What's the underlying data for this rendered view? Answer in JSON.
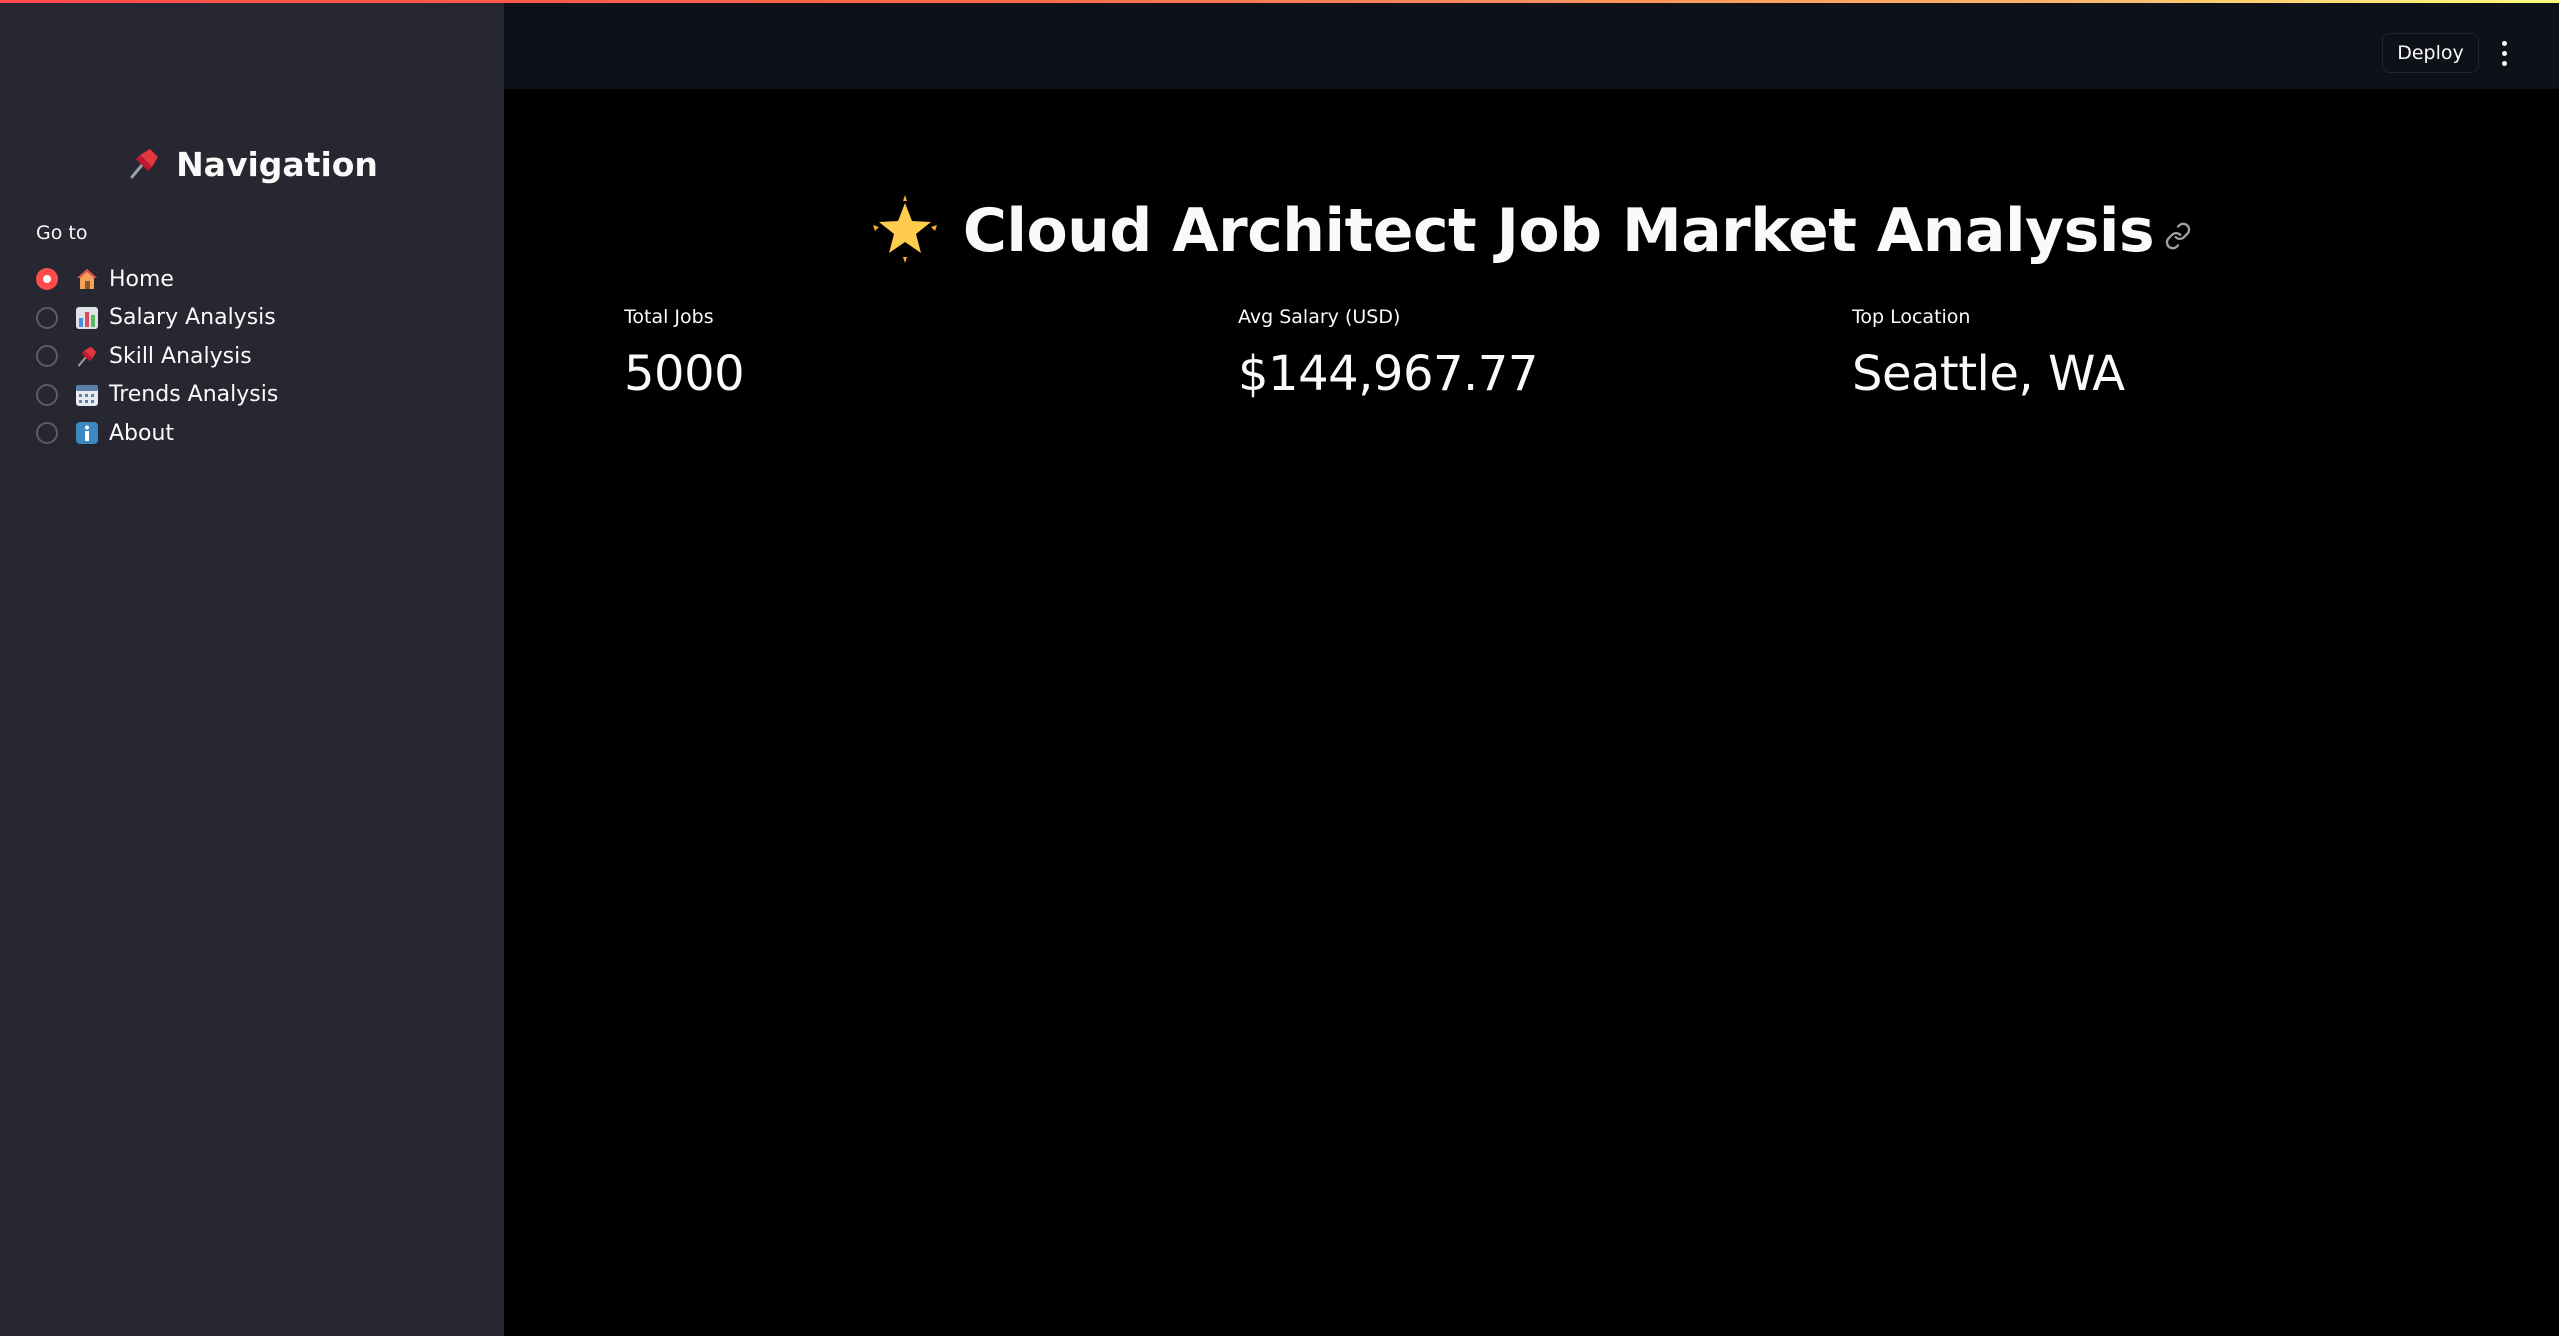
{
  "header": {
    "deploy_label": "Deploy",
    "menu_icon": "kebab-menu-icon"
  },
  "sidebar": {
    "title": "Navigation",
    "title_icon": "pushpin-icon",
    "goto_label": "Go to",
    "selected": "Home",
    "accent_color": "#ff4b4b",
    "items": [
      {
        "label": "Home",
        "icon": "house-icon",
        "checked": true
      },
      {
        "label": "Salary Analysis",
        "icon": "bar-chart-icon",
        "checked": false
      },
      {
        "label": "Skill Analysis",
        "icon": "pushpin-icon",
        "checked": false
      },
      {
        "label": "Trends Analysis",
        "icon": "calendar-icon",
        "checked": false
      },
      {
        "label": "About",
        "icon": "info-icon",
        "checked": false
      }
    ]
  },
  "main": {
    "title": "Cloud Architect Job Market Analysis",
    "title_icon": "glowing-star-icon",
    "anchor_icon": "link-icon",
    "metrics": [
      {
        "label": "Total Jobs",
        "value": "5000"
      },
      {
        "label": "Avg Salary (USD)",
        "value": "$144,967.77"
      },
      {
        "label": "Top Location",
        "value": "Seattle, WA"
      }
    ]
  },
  "colors": {
    "sidebar_bg": "#262730",
    "header_bg": "#0e1117",
    "main_bg": "#000000",
    "text": "#fafafa"
  }
}
